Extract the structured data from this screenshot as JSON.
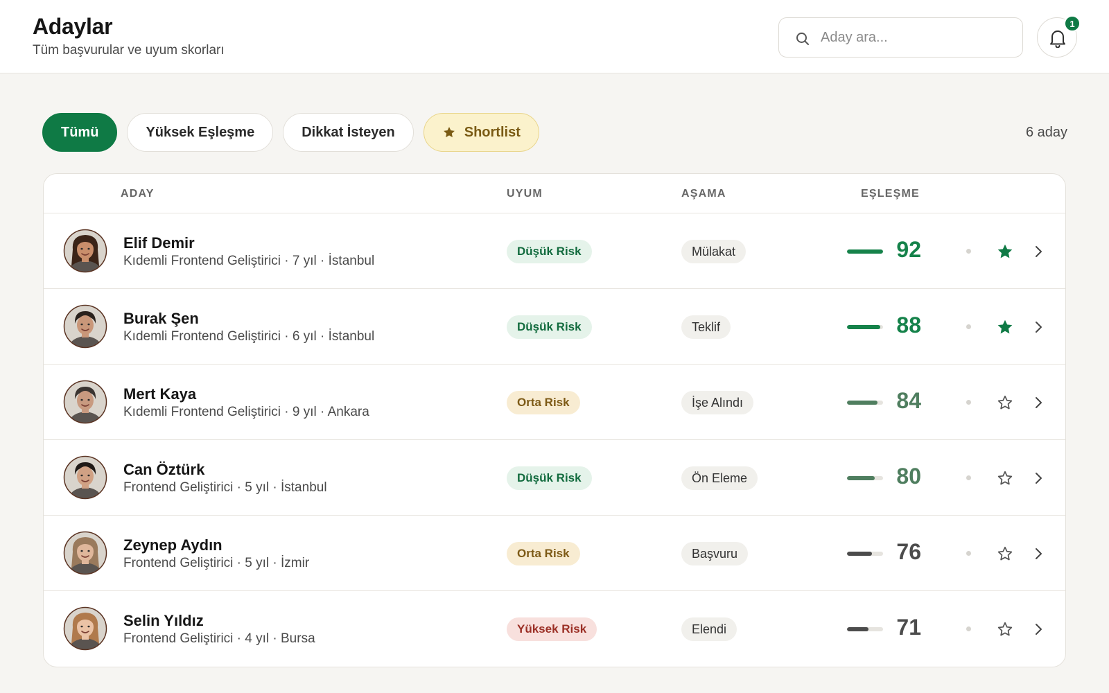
{
  "header": {
    "title": "Adaylar",
    "subtitle": "Tüm başvurular ve uyum skorları",
    "search_placeholder": "Aday ara...",
    "notification_count": "1"
  },
  "filters": [
    {
      "label": "Tümü",
      "state": "active"
    },
    {
      "label": "Yüksek Eşleşme",
      "state": "default"
    },
    {
      "label": "Dikkat İsteyen",
      "state": "default"
    },
    {
      "label": "Shortlist",
      "state": "shortlist",
      "icon": "star-icon"
    }
  ],
  "candidate_count": "6 aday",
  "table": {
    "columns": [
      "ADAY",
      "UYUM",
      "AŞAMA",
      "EŞLEŞME"
    ],
    "rows": [
      {
        "name": "Elif Demir",
        "meta": "Kıdemli Frontend Geliştirici · 7 yıl · İstanbul",
        "risk": "Düşük Risk",
        "risk_level": "low",
        "stage": "Mülakat",
        "score": "92",
        "match": 0.92,
        "starred": true,
        "avatar": {
          "skin": "#c98e6b",
          "hair": "#3b2418",
          "long_hair": true
        }
      },
      {
        "name": "Burak Şen",
        "meta": "Kıdemli Frontend Geliştirici · 6 yıl · İstanbul",
        "risk": "Düşük Risk",
        "risk_level": "low",
        "stage": "Teklif",
        "score": "88",
        "match": 0.88,
        "starred": true,
        "avatar": {
          "skin": "#c99779",
          "hair": "#2a221d",
          "long_hair": false
        }
      },
      {
        "name": "Mert Kaya",
        "meta": "Kıdemli Frontend Geliştirici · 9 yıl · Ankara",
        "risk": "Orta Risk",
        "risk_level": "mid",
        "stage": "İşe Alındı",
        "score": "84",
        "match": 0.84,
        "starred": false,
        "avatar": {
          "skin": "#c89a80",
          "hair": "#3a3431",
          "long_hair": false
        }
      },
      {
        "name": "Can Öztürk",
        "meta": "Frontend Geliştirici · 5 yıl · İstanbul",
        "risk": "Düşük Risk",
        "risk_level": "low",
        "stage": "Ön Eleme",
        "score": "80",
        "match": 0.8,
        "starred": false,
        "avatar": {
          "skin": "#d0a184",
          "hair": "#1f1a17",
          "long_hair": false
        }
      },
      {
        "name": "Zeynep Aydın",
        "meta": "Frontend Geliştirici · 5 yıl · İzmir",
        "risk": "Orta Risk",
        "risk_level": "mid",
        "stage": "Başvuru",
        "score": "76",
        "match": 0.76,
        "starred": false,
        "avatar": {
          "skin": "#e0b79b",
          "hair": "#9a7a5c",
          "long_hair": true
        }
      },
      {
        "name": "Selin Yıldız",
        "meta": "Frontend Geliştirici · 4 yıl · Bursa",
        "risk": "Yüksek Risk",
        "risk_level": "high",
        "stage": "Elendi",
        "score": "71",
        "match": 0.71,
        "starred": false,
        "avatar": {
          "skin": "#ebc3a6",
          "hair": "#b07a4c",
          "long_hair": true
        }
      }
    ]
  },
  "colors": {
    "brand_green": "#0f7a45",
    "risk_low": "#126b3e",
    "risk_mid": "#7d5a16",
    "risk_high": "#9b2f25",
    "shortlist_bg": "#fbf2cc",
    "score_strong": "#15824a",
    "score_mid": "#4f7e5f",
    "score_low": "#4c4c4c"
  }
}
